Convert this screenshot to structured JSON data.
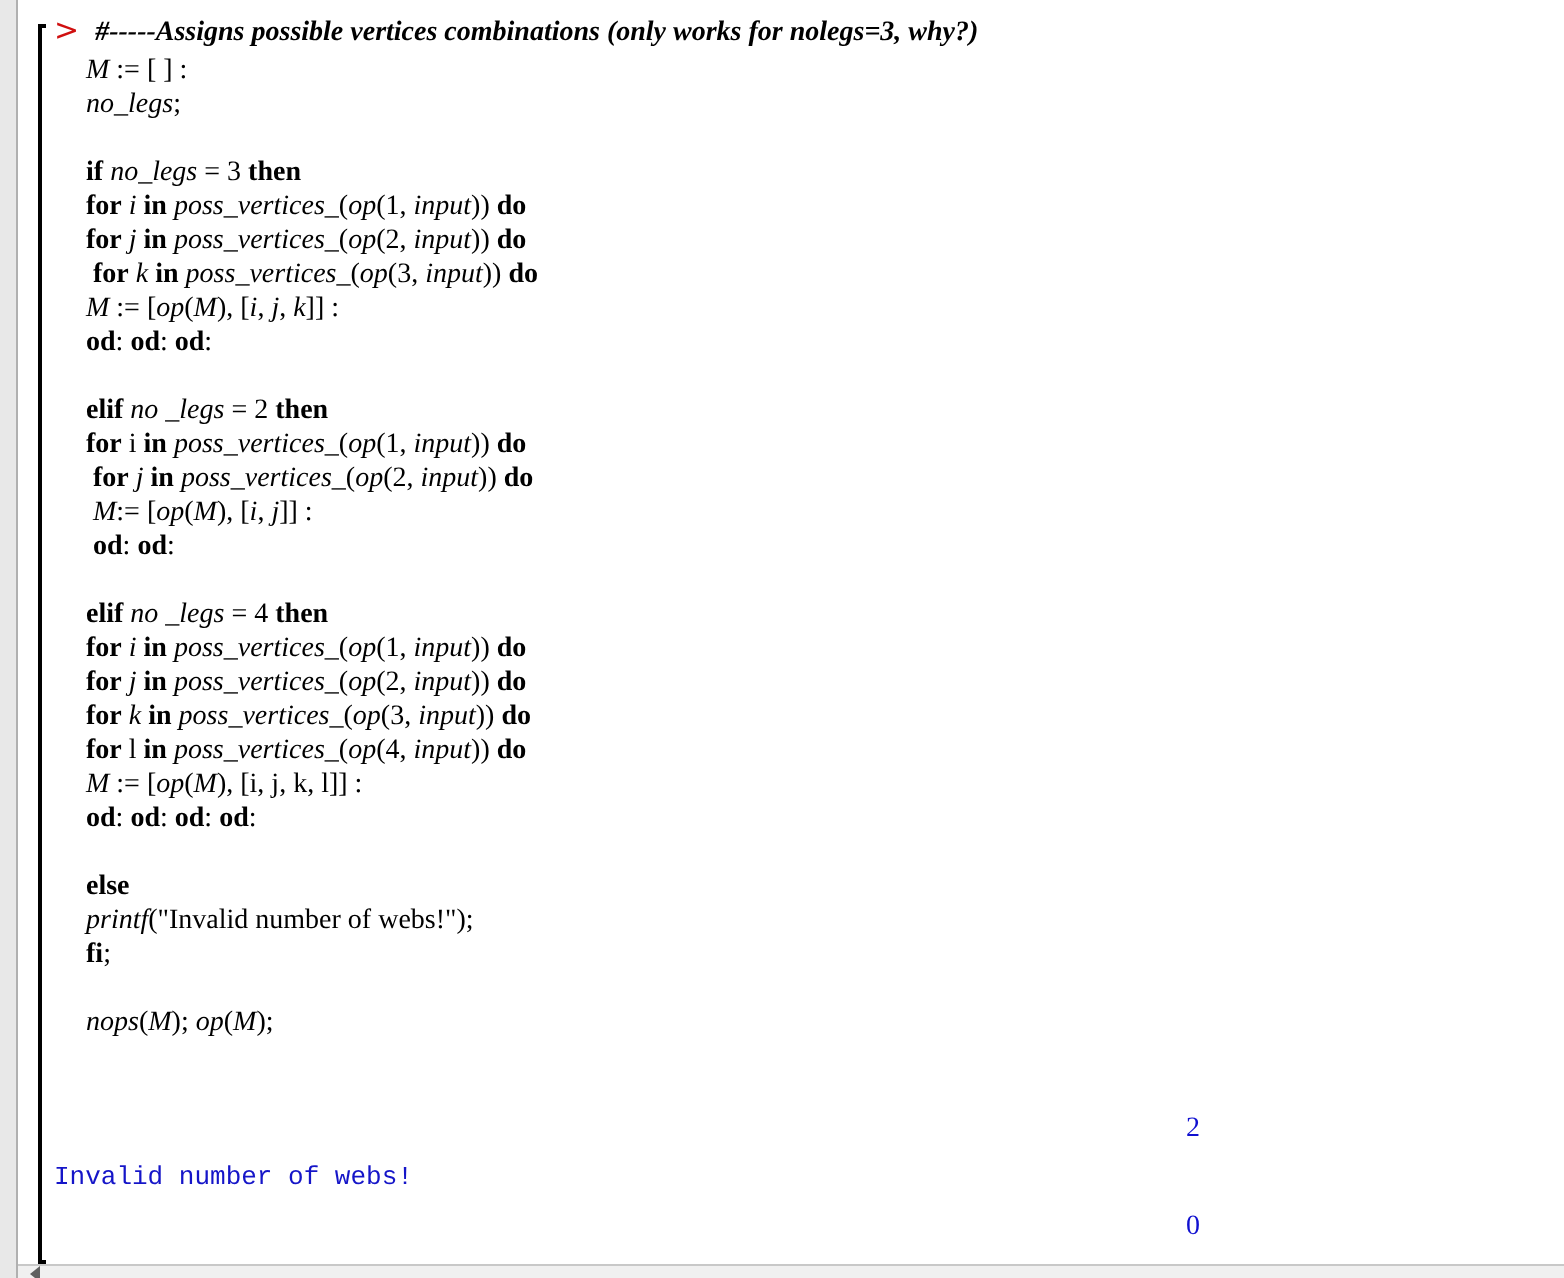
{
  "prompt": ">",
  "comment": "#-----Assigns possible vertices combinations (only works for nolegs=3, why?)",
  "blocks": [
    [
      "*M* := [ ] :",
      "*no_legs*;"
    ],
    [
      "**if** *no_legs* = 3 **then**",
      "**for** *i* **in** *poss_vertices_*(*op*(1, *input*)) **do**",
      "**for** *j* **in** *poss_vertices_*(*op*(2, *input*)) **do**",
      " **for** *k* **in** *poss_vertices_*(*op*(3, *input*)) **do**",
      "*M* := [*op*(*M*), [*i*, *j*, *k*]] :",
      "**od**: **od**: **od**:"
    ],
    [
      "**elif** *no _legs* = 2 **then**",
      "**for** i **in** *poss_vertices_*(*op*(1, *input*)) **do**",
      " **for** *j* **in** *poss_vertices_*(*op*(2, *input*)) **do**",
      " *M*:= [*op*(*M*), [*i*, *j*]] :",
      " **od**: **od**:"
    ],
    [
      "**elif** *no _legs* = 4 **then**",
      "**for** *i* **in** *poss_vertices_*(*op*(1, *input*)) **do**",
      "**for** *j* **in** *poss_vertices_*(*op*(2, *input*)) **do**",
      "**for** *k* **in** *poss_vertices_*(*op*(3, *input*)) **do**",
      "**for** l **in** *poss_vertices_*(*op*(4, *input*)) **do**",
      "*M* := [*op*(*M*), [i, j, k, l]] :",
      "**od**: **od**: **od**: **od**:"
    ],
    [
      "**else**",
      "*printf*(\"Invalid number of webs!\");",
      "**fi**;"
    ],
    [
      "*nops*(*M*); *op*(*M*);"
    ]
  ],
  "outputs": [
    {
      "kind": "math",
      "text": "2"
    },
    {
      "kind": "print",
      "text": "Invalid number of webs!"
    },
    {
      "kind": "math",
      "text": "0"
    }
  ]
}
